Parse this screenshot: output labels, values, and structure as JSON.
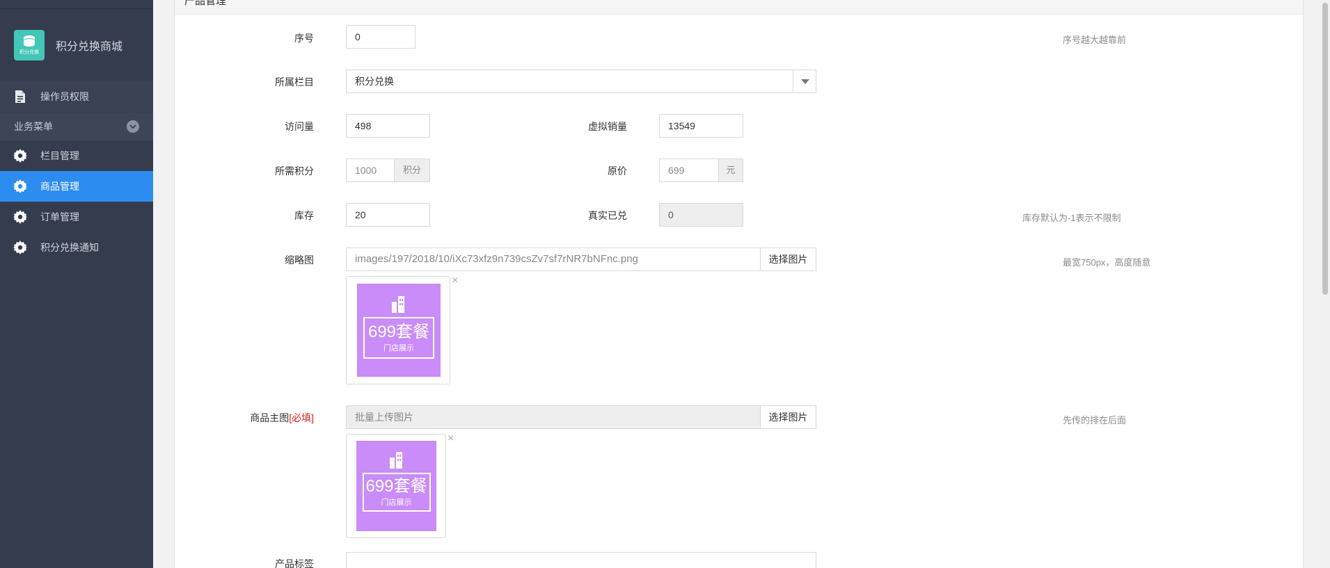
{
  "sidebar": {
    "brand_title": "积分兑换商城",
    "logo_text": "积分兑换",
    "top_item": "操作员权限",
    "section_title": "业务菜单",
    "items": [
      {
        "label": "栏目管理"
      },
      {
        "label": "商品管理"
      },
      {
        "label": "订单管理"
      },
      {
        "label": "积分兑换通知"
      }
    ],
    "active_index": 1,
    "colors": {
      "bg": "#353c4d",
      "active": "#2d8cf0"
    }
  },
  "panel": {
    "title": "产品管理"
  },
  "form": {
    "order": {
      "label": "序号",
      "value": "0",
      "hint": "序号越大越靠前"
    },
    "category": {
      "label": "所属栏目",
      "value": "积分兑换"
    },
    "views": {
      "label": "访问量",
      "value": "498"
    },
    "virtual_sales": {
      "label": "虚拟销量",
      "value": "13549"
    },
    "points": {
      "label": "所需积分",
      "value": "1000",
      "addon": "积分"
    },
    "original_price": {
      "label": "原价",
      "value": "699",
      "addon": "元"
    },
    "stock": {
      "label": "库存",
      "value": "20",
      "hint": "库存默认为-1表示不限制"
    },
    "real_redeemed": {
      "label": "真实已兑",
      "value": "0"
    },
    "thumbnail": {
      "label": "缩略图",
      "value": "images/197/2018/10/iXc73xfz9n739csZv7sf7rNR7bNFnc.png",
      "button": "选择图片",
      "hint": "最宽750px，高度随意",
      "preview_title": "699套餐",
      "preview_sub": "门店展示"
    },
    "main_image": {
      "label": "商品主图",
      "required": "[必填]",
      "placeholder": "批量上传图片",
      "button": "选择图片",
      "hint": "先传的排在后面",
      "preview_title": "699套餐",
      "preview_sub": "门店展示"
    },
    "next_label_partial": "产品标签"
  },
  "close_glyph": "×"
}
